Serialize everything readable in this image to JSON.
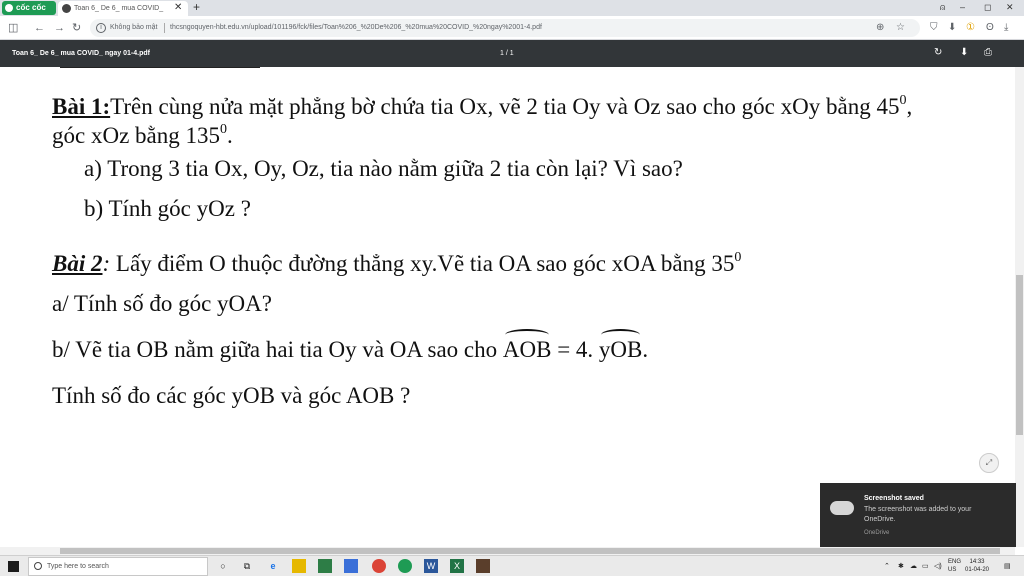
{
  "browser": {
    "brand": "cốc cốc",
    "tab_title": "Toan 6_ De 6_ mua COVID_",
    "tab_close": "✕",
    "new_tab": "+",
    "security_label": "Không bảo mật",
    "url": "thcsngoquyen-hbt.edu.vn/upload/101196/fck/files/Toan%206_%20De%206_%20mua%20COVID_%20ngay%2001-4.pdf",
    "window_controls": [
      "–",
      "◻",
      "✕"
    ]
  },
  "pdf_viewer": {
    "title": "Toan 6_ De 6_ mua COVID_ ngay 01-4.pdf",
    "page_indicator": "1 / 1"
  },
  "document": {
    "bai1_heading": "Bài 1:",
    "bai1_text": "Trên cùng nửa mặt phẳng bờ chứa tia Ox, vẽ 2 tia Oy và Oz sao cho góc xOy bằng 45",
    "bai1_sup1": "0",
    "bai1_tail": ",",
    "bai1_line2": "góc xOz bằng 135",
    "bai1_sup2": "0",
    "bai1_line2_tail": ".",
    "q1a": "a)  Trong 3 tia Ox, Oy, Oz, tia nào nằm giữa 2 tia còn lại? Vì sao?",
    "q1b": "b)  Tính góc yOz ?",
    "bai2_heading": "Bài 2",
    "bai2_colon": ":",
    "bai2_text": " Lấy điểm O thuộc đường thẳng xy.Vẽ tia OA sao góc xOA bằng 35",
    "bai2_sup": "0",
    "q2a": "a/ Tính số đo góc yOA?",
    "q2b_text": "b/ Vẽ tia OB nằm giữa hai tia Oy và OA sao cho ",
    "q2b_angle1": "AOB",
    "q2b_mid": " = 4. ",
    "q2b_angle2": "yOB",
    "q2b_end": ".",
    "q2c": "Tính số đo các góc yOB và góc AOB ?"
  },
  "notification": {
    "title": "Screenshot saved",
    "body": "The screenshot was added to your OneDrive.",
    "source": "OneDrive"
  },
  "taskbar": {
    "search_placeholder": "Type here to search",
    "language": "ENG",
    "locale": "US",
    "time": "14:33",
    "date": "01-04-20"
  }
}
